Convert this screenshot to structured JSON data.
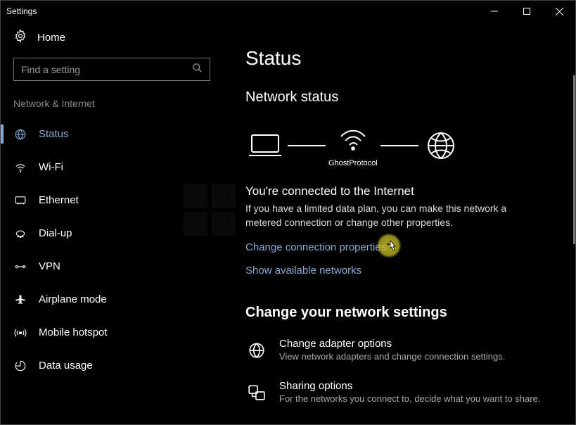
{
  "titlebar": {
    "title": "Settings"
  },
  "sidebar": {
    "home_label": "Home",
    "search_placeholder": "Find a setting",
    "section_label": "Network & Internet",
    "items": [
      {
        "label": "Status"
      },
      {
        "label": "Wi-Fi"
      },
      {
        "label": "Ethernet"
      },
      {
        "label": "Dial-up"
      },
      {
        "label": "VPN"
      },
      {
        "label": "Airplane mode"
      },
      {
        "label": "Mobile hotspot"
      },
      {
        "label": "Data usage"
      }
    ]
  },
  "main": {
    "page_title": "Status",
    "network_status_label": "Network status",
    "diagram_label": "GhostProtocol",
    "connected_heading": "You're connected to the Internet",
    "connected_desc": "If you have a limited data plan, you can make this network a metered connection or change other properties.",
    "change_props_link": "Change connection properties",
    "show_networks_link": "Show available networks",
    "change_settings_title": "Change your network settings",
    "settings": [
      {
        "label": "Change adapter options",
        "desc": "View network adapters and change connection settings."
      },
      {
        "label": "Sharing options",
        "desc": "For the networks you connect to, decide what you want to share."
      }
    ]
  }
}
